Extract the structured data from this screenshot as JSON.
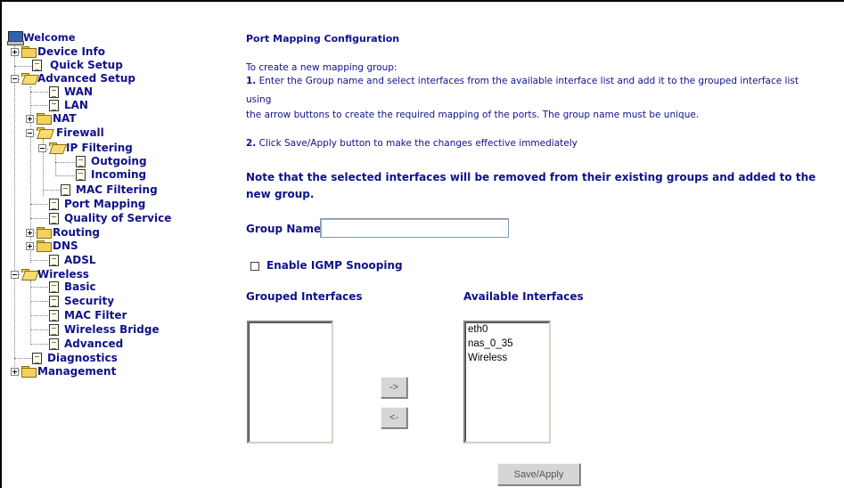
{
  "tree": {
    "welcome": "Welcome",
    "device_info": "Device Info",
    "quick_setup": "Quick Setup",
    "advanced_setup": "Advanced Setup",
    "wan": "WAN",
    "lan": "LAN",
    "nat": "NAT",
    "firewall": "Firewall",
    "ip_filtering": "IP Filtering",
    "outgoing": "Outgoing",
    "incoming": "Incoming",
    "mac_filtering": "MAC Filtering",
    "port_mapping": "Port Mapping",
    "qos": "Quality of Service",
    "routing": "Routing",
    "dns": "DNS",
    "adsl": "ADSL",
    "wireless": "Wireless",
    "basic": "Basic",
    "security": "Security",
    "mac_filter": "MAC Filter",
    "wireless_bridge": "Wireless Bridge",
    "advanced": "Advanced",
    "diagnostics": "Diagnostics",
    "management": "Management"
  },
  "page": {
    "title": "Port Mapping Configuration",
    "intro": "To create a new mapping group:",
    "step1_num": "1.",
    "step1_text": " Enter the Group name and select interfaces from the available interface list and add it to the grouped interface list",
    "step1_using": "using",
    "step1_rest": "the arrow buttons to create the required mapping of the ports. The group name must be unique.",
    "step2_num": "2.",
    "step2_text": " Click Save/Apply button to make the changes effective immediately",
    "note": "Note that the selected interfaces will be removed from their existing groups and added to the new group.",
    "group_name_label": "Group Name:",
    "group_name_value": "",
    "igmp_label": "Enable IGMP Snooping",
    "igmp_checked": false,
    "grouped_label": "Grouped Interfaces",
    "available_label": "Available Interfaces",
    "grouped_items": [],
    "available_items": [
      "eth0",
      "nas_0_35",
      "Wireless"
    ],
    "add_button": "->",
    "remove_button": "<-",
    "save_button": "Save/Apply"
  }
}
